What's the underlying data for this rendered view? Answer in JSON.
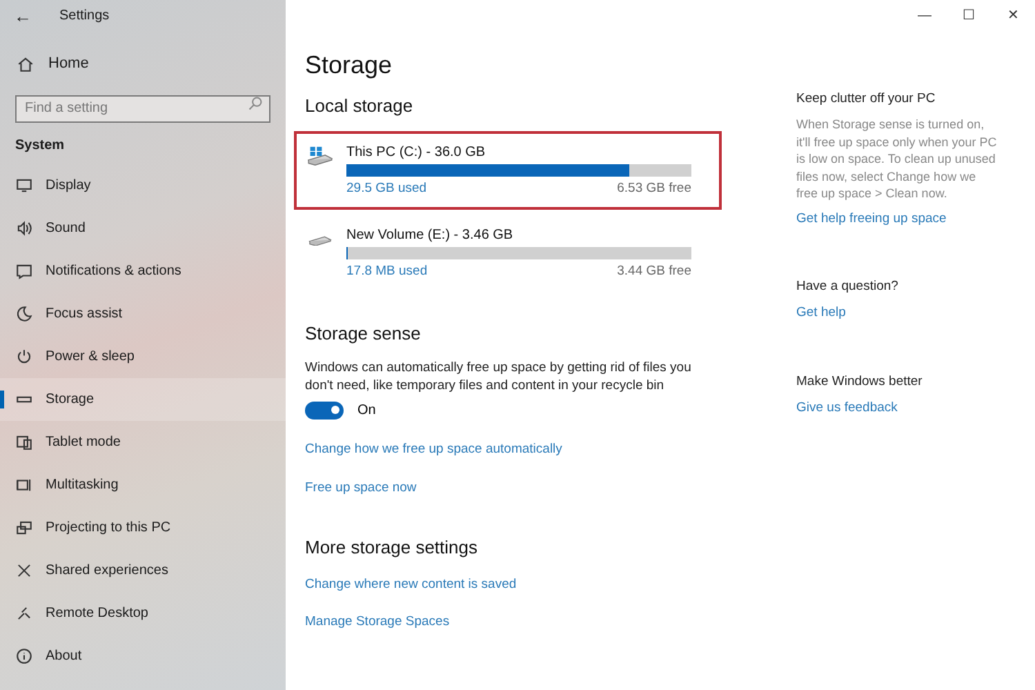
{
  "window": {
    "back": "←",
    "title": "Settings",
    "controls": [
      "—",
      "☐",
      "✕"
    ]
  },
  "sidebar": {
    "home": "Home",
    "search": {
      "placeholder": "Find a setting"
    },
    "section": "System",
    "items": [
      {
        "label": "Display",
        "selected": false
      },
      {
        "label": "Sound",
        "selected": false
      },
      {
        "label": "Notifications & actions",
        "selected": false
      },
      {
        "label": "Focus assist",
        "selected": false
      },
      {
        "label": "Power & sleep",
        "selected": false
      },
      {
        "label": "Storage",
        "selected": true
      },
      {
        "label": "Tablet mode",
        "selected": false
      },
      {
        "label": "Multitasking",
        "selected": false
      },
      {
        "label": "Projecting to this PC",
        "selected": false
      },
      {
        "label": "Shared experiences",
        "selected": false
      },
      {
        "label": "Remote Desktop",
        "selected": false
      },
      {
        "label": "About",
        "selected": false
      }
    ]
  },
  "main": {
    "title": "Storage",
    "local_storage": {
      "heading": "Local storage",
      "drives": [
        {
          "name": "This PC (C:) - 36.0 GB",
          "used": "29.5 GB used",
          "free": "6.53 GB free",
          "level": 0.82,
          "highlighted": true,
          "system": true
        },
        {
          "name": "New Volume (E:) - 3.46 GB",
          "used": "17.8 MB used",
          "free": "3.44 GB free",
          "level": 0.005,
          "highlighted": false,
          "system": false
        }
      ]
    },
    "storage_sense": {
      "heading": "Storage sense",
      "description": "Windows can automatically free up space by getting rid of files you don't need, like temporary files and content in your recycle bin",
      "toggle": {
        "on": true,
        "label": "On"
      },
      "links": [
        "Change how we free up space automatically",
        "Free up space now"
      ]
    },
    "more": {
      "heading": "More storage settings",
      "links": [
        "Change where new content is saved",
        "Manage Storage Spaces"
      ]
    }
  },
  "aside": [
    {
      "heading": "Keep clutter off your PC",
      "text": "When Storage sense is turned on, it'll free up space only when your PC is low on space. To clean up unused files now, select Change how we free up space > Clean now.",
      "link": "Get help freeing up space"
    },
    {
      "heading": "Have a question?",
      "link": "Get help"
    },
    {
      "heading": "Make Windows better",
      "link": "Give us feedback"
    }
  ]
}
